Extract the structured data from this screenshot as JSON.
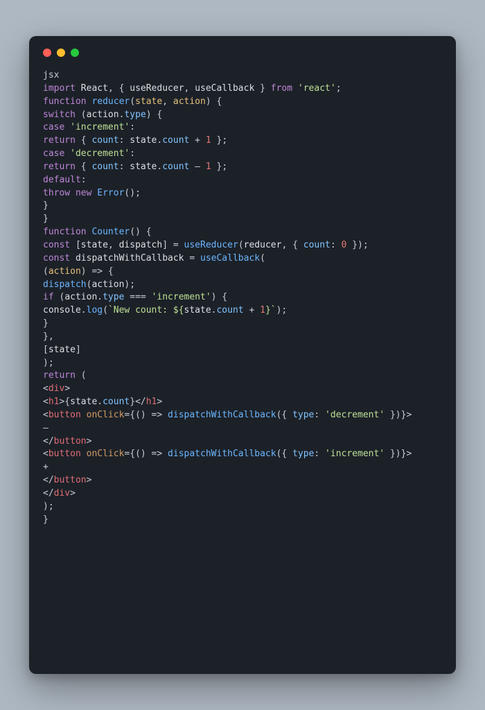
{
  "code": {
    "tokens": [
      [
        [
          "plain",
          "jsx"
        ]
      ],
      [
        [
          "keyword",
          "import"
        ],
        [
          "plain",
          " "
        ],
        [
          "ident",
          "React"
        ],
        [
          "punc",
          ", { "
        ],
        [
          "ident",
          "useReducer"
        ],
        [
          "punc",
          ", "
        ],
        [
          "ident",
          "useCallback"
        ],
        [
          "punc",
          " } "
        ],
        [
          "keyword",
          "from"
        ],
        [
          "plain",
          " "
        ],
        [
          "string",
          "'react'"
        ],
        [
          "punc",
          ";"
        ]
      ],
      [
        [
          "keyword",
          "function"
        ],
        [
          "plain",
          " "
        ],
        [
          "func",
          "reducer"
        ],
        [
          "punc",
          "("
        ],
        [
          "param",
          "state"
        ],
        [
          "punc",
          ", "
        ],
        [
          "param",
          "action"
        ],
        [
          "punc",
          ") {"
        ]
      ],
      [
        [
          "keyword",
          "switch"
        ],
        [
          "plain",
          " ("
        ],
        [
          "ident",
          "action"
        ],
        [
          "punc",
          "."
        ],
        [
          "prop",
          "type"
        ],
        [
          "punc",
          ") {"
        ]
      ],
      [
        [
          "keyword",
          "case"
        ],
        [
          "plain",
          " "
        ],
        [
          "string",
          "'increment'"
        ],
        [
          "punc",
          ":"
        ]
      ],
      [
        [
          "keyword",
          "return"
        ],
        [
          "plain",
          " { "
        ],
        [
          "prop",
          "count"
        ],
        [
          "punc",
          ": "
        ],
        [
          "ident",
          "state"
        ],
        [
          "punc",
          "."
        ],
        [
          "prop",
          "count"
        ],
        [
          "plain",
          " + "
        ],
        [
          "num",
          "1"
        ],
        [
          "plain",
          " };"
        ]
      ],
      [
        [
          "keyword",
          "case"
        ],
        [
          "plain",
          " "
        ],
        [
          "string",
          "'decrement'"
        ],
        [
          "punc",
          ":"
        ]
      ],
      [
        [
          "keyword",
          "return"
        ],
        [
          "plain",
          " { "
        ],
        [
          "prop",
          "count"
        ],
        [
          "punc",
          ": "
        ],
        [
          "ident",
          "state"
        ],
        [
          "punc",
          "."
        ],
        [
          "prop",
          "count"
        ],
        [
          "plain",
          " – "
        ],
        [
          "num",
          "1"
        ],
        [
          "plain",
          " };"
        ]
      ],
      [
        [
          "keyword",
          "default"
        ],
        [
          "punc",
          ":"
        ]
      ],
      [
        [
          "keyword",
          "throw"
        ],
        [
          "plain",
          " "
        ],
        [
          "keyword",
          "new"
        ],
        [
          "plain",
          " "
        ],
        [
          "func",
          "Error"
        ],
        [
          "punc",
          "();"
        ]
      ],
      [
        [
          "punc",
          "}"
        ]
      ],
      [
        [
          "punc",
          "}"
        ]
      ],
      [
        [
          "keyword",
          "function"
        ],
        [
          "plain",
          " "
        ],
        [
          "func",
          "Counter"
        ],
        [
          "punc",
          "() {"
        ]
      ],
      [
        [
          "keyword",
          "const"
        ],
        [
          "plain",
          " ["
        ],
        [
          "ident",
          "state"
        ],
        [
          "punc",
          ", "
        ],
        [
          "ident",
          "dispatch"
        ],
        [
          "punc",
          "] = "
        ],
        [
          "func",
          "useReducer"
        ],
        [
          "punc",
          "("
        ],
        [
          "ident",
          "reducer"
        ],
        [
          "punc",
          ", { "
        ],
        [
          "prop",
          "count"
        ],
        [
          "punc",
          ": "
        ],
        [
          "num",
          "0"
        ],
        [
          "plain",
          " });"
        ]
      ],
      [
        [
          "keyword",
          "const"
        ],
        [
          "plain",
          " "
        ],
        [
          "ident",
          "dispatchWithCallback"
        ],
        [
          "plain",
          " = "
        ],
        [
          "func",
          "useCallback"
        ],
        [
          "punc",
          "("
        ]
      ],
      [
        [
          "punc",
          "("
        ],
        [
          "param",
          "action"
        ],
        [
          "punc",
          ") => {"
        ]
      ],
      [
        [
          "func",
          "dispatch"
        ],
        [
          "punc",
          "("
        ],
        [
          "ident",
          "action"
        ],
        [
          "punc",
          ");"
        ]
      ],
      [
        [
          "keyword",
          "if"
        ],
        [
          "plain",
          " ("
        ],
        [
          "ident",
          "action"
        ],
        [
          "punc",
          "."
        ],
        [
          "prop",
          "type"
        ],
        [
          "plain",
          " === "
        ],
        [
          "string",
          "'increment'"
        ],
        [
          "punc",
          ") {"
        ]
      ],
      [
        [
          "ident",
          "console"
        ],
        [
          "punc",
          "."
        ],
        [
          "func",
          "log"
        ],
        [
          "punc",
          "("
        ],
        [
          "string",
          "`New count: ${"
        ],
        [
          "ident",
          "state"
        ],
        [
          "punc",
          "."
        ],
        [
          "prop",
          "count"
        ],
        [
          "plain",
          " + "
        ],
        [
          "num",
          "1"
        ],
        [
          "string",
          "}`"
        ],
        [
          "punc",
          ");"
        ]
      ],
      [
        [
          "punc",
          "}"
        ]
      ],
      [
        [
          "punc",
          "},"
        ]
      ],
      [
        [
          "punc",
          "["
        ],
        [
          "ident",
          "state"
        ],
        [
          "punc",
          "]"
        ]
      ],
      [
        [
          "punc",
          ");"
        ]
      ],
      [
        [
          "keyword",
          "return"
        ],
        [
          "plain",
          " ("
        ]
      ],
      [
        [
          "punc",
          "<"
        ],
        [
          "tag",
          "div"
        ],
        [
          "punc",
          ">"
        ]
      ],
      [
        [
          "punc",
          "<"
        ],
        [
          "tag",
          "h1"
        ],
        [
          "punc",
          ">{"
        ],
        [
          "ident",
          "state"
        ],
        [
          "punc",
          "."
        ],
        [
          "prop",
          "count"
        ],
        [
          "punc",
          "}</"
        ],
        [
          "tag",
          "h1"
        ],
        [
          "punc",
          ">"
        ]
      ],
      [
        [
          "punc",
          "<"
        ],
        [
          "tag",
          "button"
        ],
        [
          "plain",
          " "
        ],
        [
          "attr",
          "onClick"
        ],
        [
          "punc",
          "={() => "
        ],
        [
          "func",
          "dispatchWithCallback"
        ],
        [
          "punc",
          "({ "
        ],
        [
          "prop",
          "type"
        ],
        [
          "punc",
          ": "
        ],
        [
          "string",
          "'decrement'"
        ],
        [
          "plain",
          " })}>"
        ]
      ],
      [
        [
          "plain",
          "—"
        ]
      ],
      [
        [
          "punc",
          "</"
        ],
        [
          "tag",
          "button"
        ],
        [
          "punc",
          ">"
        ]
      ],
      [
        [
          "punc",
          "<"
        ],
        [
          "tag",
          "button"
        ],
        [
          "plain",
          " "
        ],
        [
          "attr",
          "onClick"
        ],
        [
          "punc",
          "={() => "
        ],
        [
          "func",
          "dispatchWithCallback"
        ],
        [
          "punc",
          "({ "
        ],
        [
          "prop",
          "type"
        ],
        [
          "punc",
          ": "
        ],
        [
          "string",
          "'increment'"
        ],
        [
          "plain",
          " })}>"
        ]
      ],
      [
        [
          "plain",
          "+"
        ]
      ],
      [
        [
          "punc",
          "</"
        ],
        [
          "tag",
          "button"
        ],
        [
          "punc",
          ">"
        ]
      ],
      [
        [
          "punc",
          "</"
        ],
        [
          "tag",
          "div"
        ],
        [
          "punc",
          ">"
        ]
      ],
      [
        [
          "punc",
          ");"
        ]
      ],
      [
        [
          "punc",
          "}"
        ]
      ]
    ]
  }
}
